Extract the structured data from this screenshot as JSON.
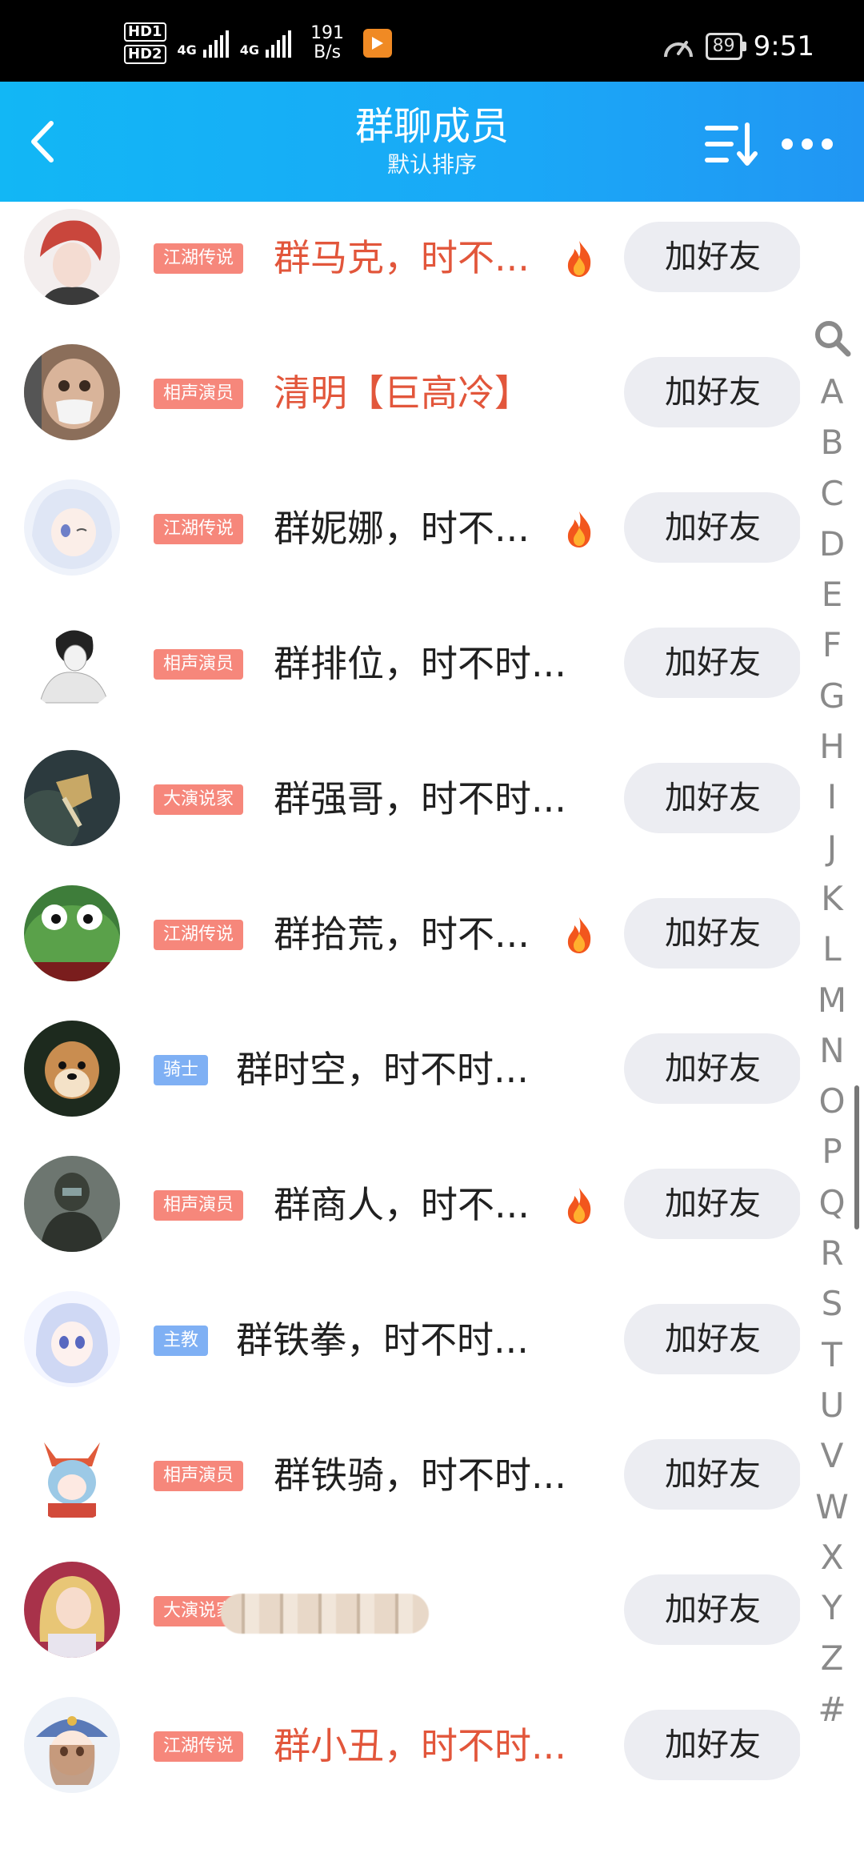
{
  "status_bar": {
    "hd1": "HD1",
    "hd2": "HD2",
    "net1": "4G",
    "net2": "4G",
    "speed_value": "191",
    "speed_unit": "B/s",
    "battery": "89",
    "time": "9:51"
  },
  "header": {
    "title": "群聊成员",
    "subtitle": "默认排序",
    "colors": {
      "gradient_start": "#12b7f5",
      "gradient_end": "#2196f3"
    }
  },
  "members": [
    {
      "tag": "江湖传说",
      "tag_color": "red",
      "name": "群马克，时不...",
      "name_color": "orange",
      "fire": true,
      "button": "加好友",
      "avatar": "avatar-red-hair"
    },
    {
      "tag": "相声演员",
      "tag_color": "red",
      "name": "清明【巨高冷】",
      "name_color": "orange",
      "fire": false,
      "button": "加好友",
      "avatar": "avatar-masked-boy"
    },
    {
      "tag": "江湖传说",
      "tag_color": "red",
      "name": "群妮娜，时不...",
      "name_color": "black",
      "fire": true,
      "button": "加好友",
      "avatar": "avatar-anime-girl"
    },
    {
      "tag": "相声演员",
      "tag_color": "red",
      "name": "群排位，时不时...",
      "name_color": "black",
      "fire": false,
      "button": "加好友",
      "avatar": "avatar-sketch-boy"
    },
    {
      "tag": "大演说家",
      "tag_color": "red",
      "name": "群强哥，时不时...",
      "name_color": "black",
      "fire": false,
      "button": "加好友",
      "avatar": "avatar-dark-sky"
    },
    {
      "tag": "江湖传说",
      "tag_color": "red",
      "name": "群拾荒，时不...",
      "name_color": "black",
      "fire": true,
      "button": "加好友",
      "avatar": "avatar-frog"
    },
    {
      "tag": "骑士",
      "tag_color": "blue",
      "name": "群时空，时不时...",
      "name_color": "black",
      "fire": false,
      "button": "加好友",
      "avatar": "avatar-dog"
    },
    {
      "tag": "相声演员",
      "tag_color": "red",
      "name": "群商人，时不...",
      "name_color": "black",
      "fire": true,
      "button": "加好友",
      "avatar": "avatar-soldier"
    },
    {
      "tag": "主教",
      "tag_color": "blue",
      "name": "群铁拳，时不时...",
      "name_color": "black",
      "fire": false,
      "button": "加好友",
      "avatar": "avatar-blue-hair-girl"
    },
    {
      "tag": "相声演员",
      "tag_color": "red",
      "name": "群铁骑，时不时...",
      "name_color": "black",
      "fire": false,
      "button": "加好友",
      "avatar": "avatar-chibi"
    },
    {
      "tag": "大演说家",
      "tag_color": "red",
      "name": "",
      "name_color": "black",
      "fire": false,
      "button": "加好友",
      "avatar": "avatar-blonde",
      "blurred": true
    },
    {
      "tag": "江湖传说",
      "tag_color": "red",
      "name": "群小丑，时不时...",
      "name_color": "orange",
      "fire": false,
      "button": "加好友",
      "avatar": "avatar-hat-girl"
    }
  ],
  "index_bar": [
    "A",
    "B",
    "C",
    "D",
    "E",
    "F",
    "G",
    "H",
    "I",
    "J",
    "K",
    "L",
    "M",
    "N",
    "O",
    "P",
    "Q",
    "R",
    "S",
    "T",
    "U",
    "V",
    "W",
    "X",
    "Y",
    "Z",
    "#"
  ]
}
